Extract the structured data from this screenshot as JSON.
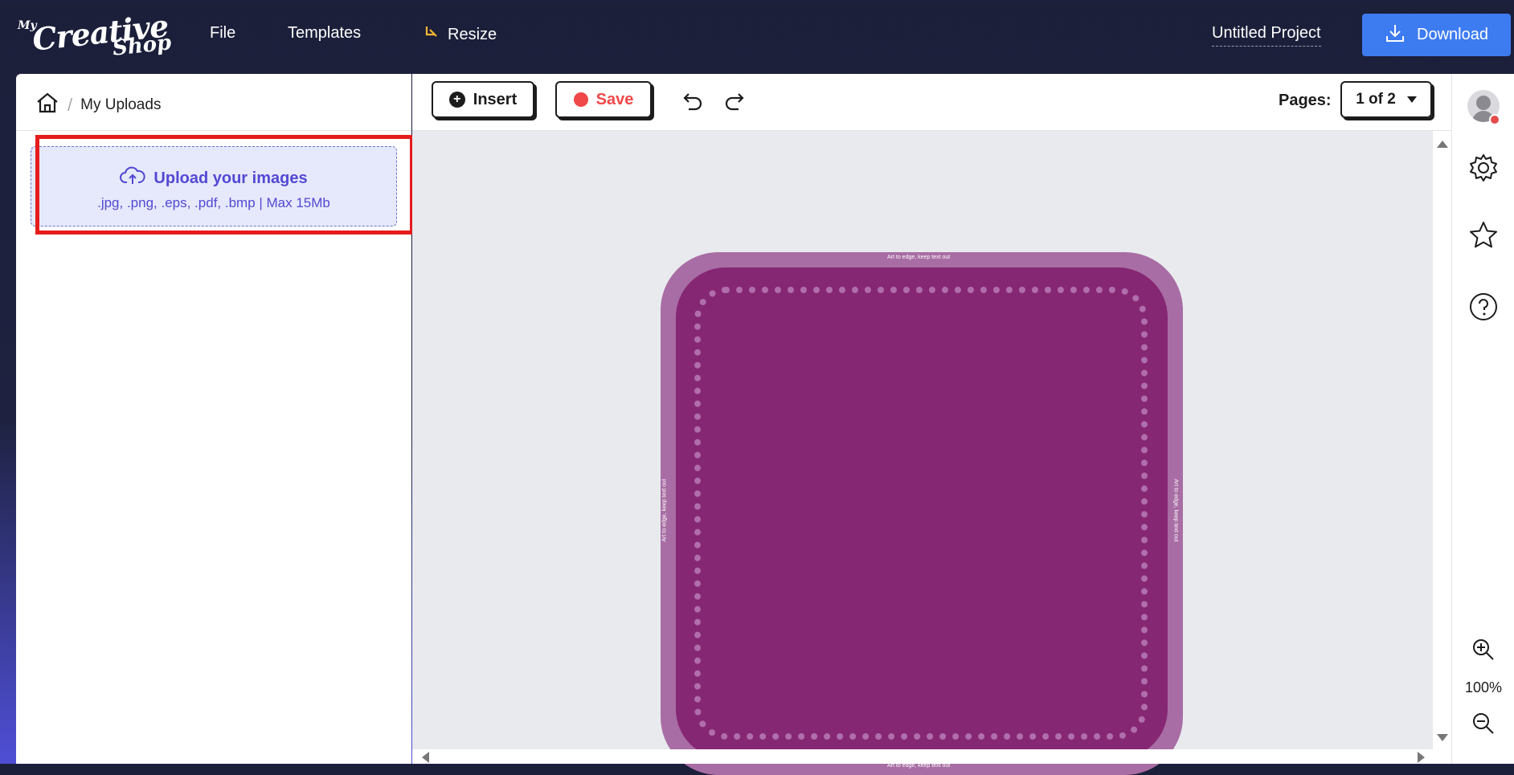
{
  "header": {
    "logo": {
      "my": "My",
      "creative": "Creative",
      "shop": "Shop"
    },
    "nav": {
      "file": "File",
      "templates": "Templates",
      "resize": "Resize"
    },
    "project_title": "Untitled Project",
    "download_label": "Download"
  },
  "left_panel": {
    "breadcrumb": {
      "separator": "/",
      "current": "My Uploads"
    },
    "upload": {
      "title": "Upload your images",
      "formats": ".jpg, .png, .eps, .pdf, .bmp | Max 15Mb"
    }
  },
  "toolbar": {
    "insert_label": "Insert",
    "save_label": "Save",
    "pages_label": "Pages:",
    "pages_value": "1 of 2"
  },
  "canvas": {
    "edge_text": "Art to edge, keep text out",
    "colors": {
      "outer": "#a86da4",
      "inner": "#862774",
      "dots": "#b06eab"
    }
  },
  "right_rail": {
    "zoom_level": "100%"
  },
  "colors": {
    "accent": "#3d7bf0",
    "save_red": "#f04848",
    "upload_purple": "#5348d3",
    "highlight": "#e51c1c"
  }
}
